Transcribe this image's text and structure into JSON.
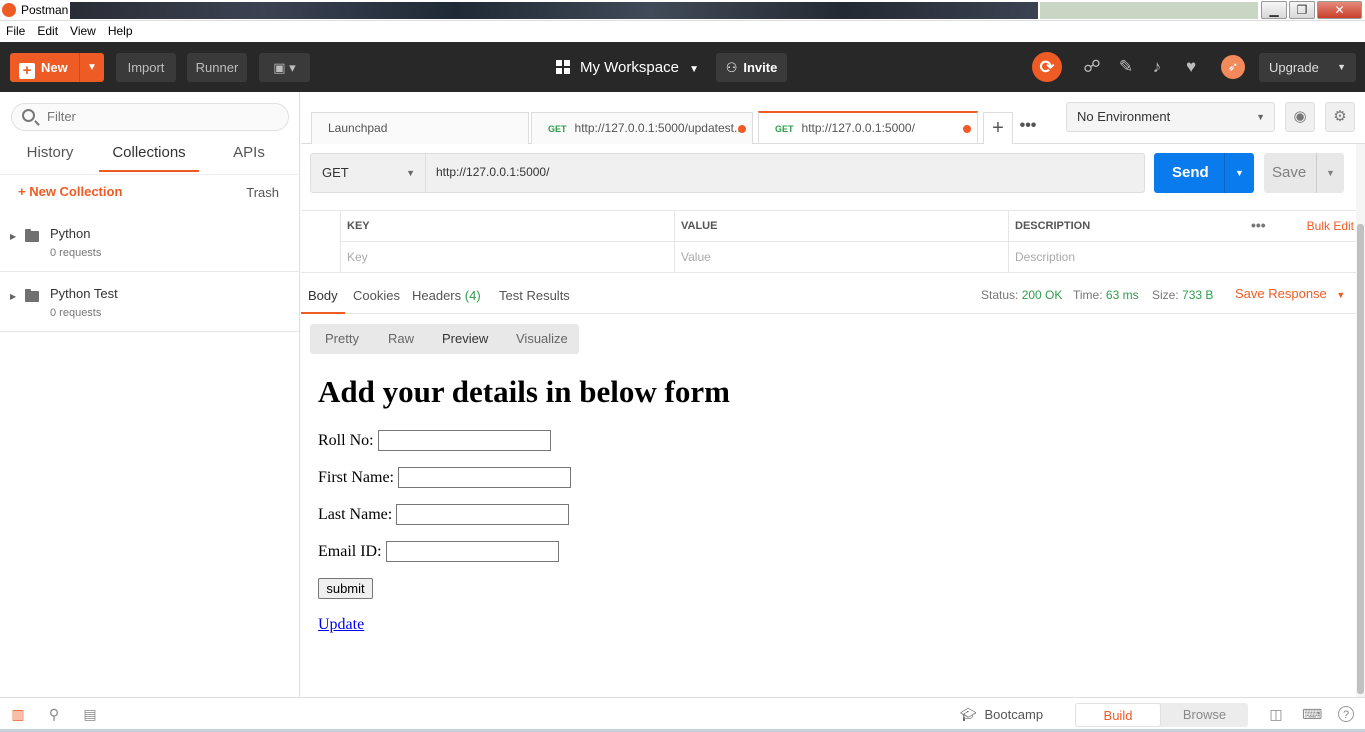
{
  "window": {
    "title": "Postman",
    "minimize": "▁",
    "maximize": "❐",
    "close": "✕"
  },
  "menu": [
    "File",
    "Edit",
    "View",
    "Help"
  ],
  "header": {
    "new_label": "New",
    "import_label": "Import",
    "runner_label": "Runner",
    "workspace_label": "My Workspace",
    "invite_label": "Invite",
    "upgrade_label": "Upgrade"
  },
  "sidebar": {
    "filter_placeholder": "Filter",
    "tabs": [
      "History",
      "Collections",
      "APIs"
    ],
    "active_tab": "Collections",
    "new_collection_label": "+ New Collection",
    "trash_label": "Trash",
    "collections": [
      {
        "name": "Python",
        "count": "0 requests"
      },
      {
        "name": "Python Test",
        "count": "0 requests"
      }
    ]
  },
  "request_tabs": [
    {
      "label": "Launchpad",
      "method": ""
    },
    {
      "label": "http://127.0.0.1:5000/updatest...",
      "method": "GET"
    },
    {
      "label": "http://127.0.0.1:5000/",
      "method": "GET"
    }
  ],
  "environment": {
    "selected": "No Environment"
  },
  "request": {
    "method": "GET",
    "url": "http://127.0.0.1:5000/",
    "send_label": "Send",
    "save_label": "Save"
  },
  "params": {
    "headers": [
      "KEY",
      "VALUE",
      "DESCRIPTION"
    ],
    "placeholders": [
      "Key",
      "Value",
      "Description"
    ],
    "more_label": "•••",
    "bulk_edit_label": "Bulk Edit"
  },
  "response": {
    "tabs": [
      "Body",
      "Cookies",
      "Headers",
      "Test Results"
    ],
    "headers_count": "(4)",
    "status_label": "Status:",
    "status_value": "200 OK",
    "time_label": "Time:",
    "time_value": "63 ms",
    "size_label": "Size:",
    "size_value": "733 B",
    "save_response_label": "Save Response",
    "views": [
      "Pretty",
      "Raw",
      "Preview",
      "Visualize"
    ],
    "active_view": "Preview"
  },
  "preview": {
    "heading": "Add your details in below form",
    "fields": [
      "Roll No:",
      "First Name:",
      "Last Name:",
      "Email ID:"
    ],
    "submit_label": "submit",
    "update_link": "Update"
  },
  "footer": {
    "bootcamp_label": "Bootcamp",
    "build_label": "Build",
    "browse_label": "Browse",
    "help_label": "?"
  }
}
